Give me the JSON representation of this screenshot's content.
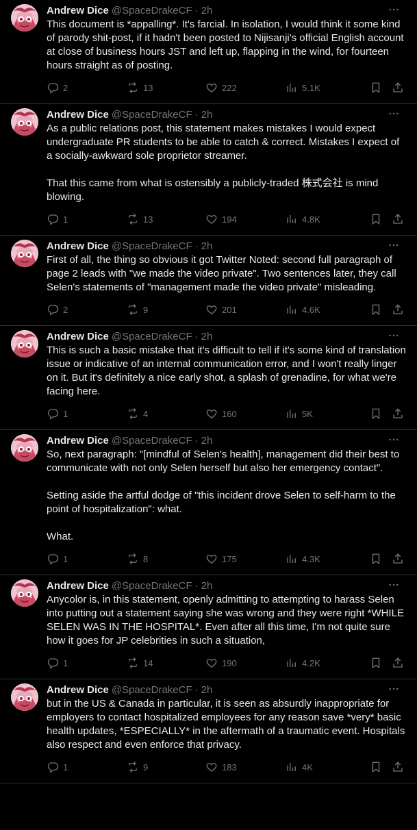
{
  "author": {
    "name": "Andrew Dice",
    "handle": "@SpaceDrakeCF",
    "time": "2h"
  },
  "tweets": [
    {
      "paragraphs": [
        "This document is *appalling*. It's farcial. In isolation, I would think it some kind of parody shit-post, if it hadn't been posted to Nijisanji's official English account at close of business hours JST and left up, flapping in the wind, for fourteen hours straight as of posting."
      ],
      "replies": "2",
      "retweets": "13",
      "likes": "222",
      "views": "5.1K"
    },
    {
      "paragraphs": [
        "As a public relations post, this statement makes mistakes I would expect undergraduate PR students to be able to catch & correct. Mistakes I expect of a socially-awkward sole proprietor streamer.",
        "That this came from what is ostensibly a publicly-traded 株式会社 is mind blowing."
      ],
      "replies": "1",
      "retweets": "13",
      "likes": "194",
      "views": "4.8K"
    },
    {
      "paragraphs": [
        "First of all, the thing so obvious it got Twitter Noted: second full paragraph of page 2 leads with \"we made the video private\". Two sentences later, they call Selen's statements of \"management made the video private\" misleading."
      ],
      "replies": "2",
      "retweets": "9",
      "likes": "201",
      "views": "4.6K"
    },
    {
      "paragraphs": [
        "This is such a basic mistake that it's difficult to tell if it's some kind of translation issue or indicative of an internal communication error, and I won't really linger on it. But it's definitely a nice early shot, a splash of grenadine, for what we're facing here."
      ],
      "replies": "1",
      "retweets": "4",
      "likes": "160",
      "views": "5K"
    },
    {
      "paragraphs": [
        "So, next paragraph: \"[mindful of Selen's health], management did their best to communicate with not only Selen herself but also her emergency contact\".",
        "Setting aside the artful dodge of \"this incident drove Selen to self-harm to the point of hospitalization\": what.",
        "What."
      ],
      "replies": "1",
      "retweets": "8",
      "likes": "175",
      "views": "4.3K"
    },
    {
      "paragraphs": [
        "Anycolor is, in this statement, openly admitting to attempting to harass Selen into putting out a statement saying she was wrong and they were right *WHILE SELEN WAS IN THE HOSPITAL*. Even after all this time, I'm not quite sure how it goes for JP celebrities in such a situation,"
      ],
      "replies": "1",
      "retweets": "14",
      "likes": "190",
      "views": "4.2K"
    },
    {
      "paragraphs": [
        "but in the US & Canada in particular, it is seen as absurdly inappropriate for employers to contact hospitalized employees for any reason save *very* basic health updates, *ESPECIALLY* in the aftermath of a traumatic event. Hospitals also respect and even enforce that privacy."
      ],
      "replies": "1",
      "retweets": "9",
      "likes": "183",
      "views": "4K"
    }
  ],
  "icons": {
    "reply": "reply-icon",
    "retweet": "retweet-icon",
    "like": "like-icon",
    "views": "views-icon",
    "bookmark": "bookmark-icon",
    "share": "share-icon",
    "more": "more-icon"
  },
  "colors": {
    "background": "#000000",
    "text": "#e7e9ea",
    "muted": "#71767b",
    "divider": "#2f3336"
  }
}
